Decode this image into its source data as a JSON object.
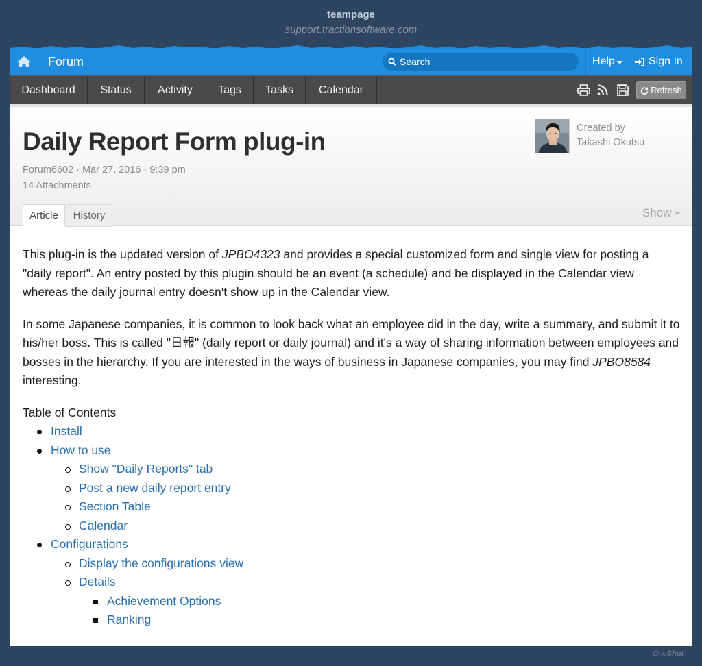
{
  "site": {
    "name": "teampage",
    "url": "support.tractionsoftware.com"
  },
  "topbar": {
    "space_label": "Forum",
    "search_placeholder": "Search",
    "help_label": "Help",
    "signin_label": "Sign In"
  },
  "nav": {
    "items": [
      "Dashboard",
      "Status",
      "Activity",
      "Tags",
      "Tasks",
      "Calendar"
    ],
    "refresh_label": "Refresh"
  },
  "article": {
    "title": "Daily Report Form plug-in",
    "meta": "Forum6602 · Mar 27, 2016 · 9:39 pm",
    "attachments": "14 Attachments",
    "created_by_label": "Created by",
    "author": "Takashi Okutsu",
    "tabs": [
      "Article",
      "History"
    ],
    "show_label": "Show",
    "p1_a": "This plug-in is the updated version of ",
    "p1_em": "JPBO4323",
    "p1_b": " and provides a special customized form and single view for posting a \"daily report\". An entry posted by this plugin should be an event (a schedule) and be displayed in the Calendar view whereas the daily journal entry doesn't show up in the Calendar view.",
    "p2_a": "In some Japanese companies, it is common to look back what an employee did in the day, write a summary, and submit it to his/her boss. This is called \"日報\" (daily report or daily journal) and it's a way of sharing information between employees and bosses in the hierarchy. If you are interested in the ways of business in Japanese companies, you may find ",
    "p2_em": "JPBO8584",
    "p2_b": " interesting.",
    "toc_title": "Table of Contents",
    "toc": {
      "install": "Install",
      "how_to_use": "How to use",
      "how_items": [
        "Show \"Daily Reports\" tab",
        "Post a new daily report entry",
        "Section Table",
        "Calendar"
      ],
      "configurations": "Configurations",
      "display_config": "Display the configurations view",
      "details": "Details",
      "details_items": [
        "Achievement Options",
        "Ranking"
      ]
    }
  },
  "watermark": {
    "one": "One",
    "shot": "Shot"
  }
}
